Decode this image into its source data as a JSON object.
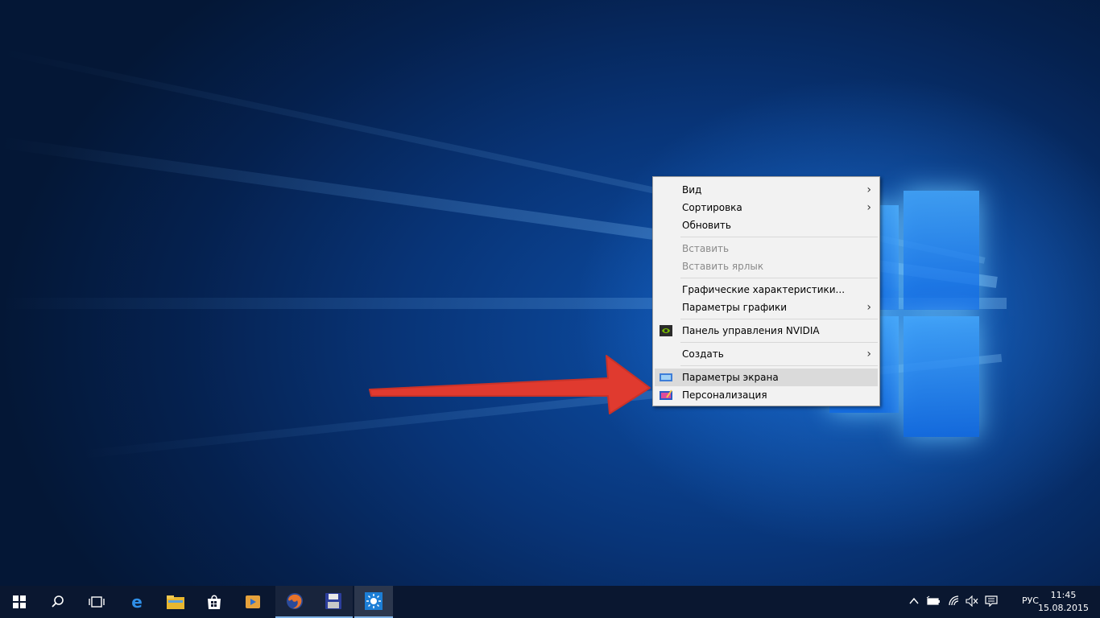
{
  "context_menu": {
    "items": [
      {
        "label": "Вид",
        "submenu": true
      },
      {
        "label": "Сортировка",
        "submenu": true
      },
      {
        "label": "Обновить"
      },
      {
        "label": "Вставить",
        "disabled": true
      },
      {
        "label": "Вставить ярлык",
        "disabled": true
      },
      {
        "label": "Графические характеристики..."
      },
      {
        "label": "Параметры графики",
        "submenu": true
      },
      {
        "label": "Панель управления NVIDIA",
        "icon": "nvidia-icon"
      },
      {
        "label": "Создать",
        "submenu": true
      },
      {
        "label": "Параметры экрана",
        "icon": "display-settings-icon",
        "highlighted": true
      },
      {
        "label": "Персонализация",
        "icon": "personalization-icon"
      }
    ],
    "submenu_glyph": "›"
  },
  "taskbar": {
    "apps": [
      "start-icon",
      "search-icon",
      "task-view-icon",
      "edge-icon",
      "file-explorer-icon",
      "store-icon",
      "media-player-icon",
      "firefox-icon",
      "save-disk-icon",
      "brightness-app-icon"
    ],
    "tray": {
      "icons": [
        "chevron-up-icon",
        "battery-icon",
        "wifi-icon",
        "volume-muted-icon",
        "action-center-icon"
      ],
      "language": "РУС",
      "time": "11:45",
      "date": "15.08.2015"
    }
  },
  "colors": {
    "arrow": "#e03a2f",
    "menu_bg": "#f2f2f2",
    "menu_highlight": "#dadada",
    "taskbar": "#0a1730"
  }
}
